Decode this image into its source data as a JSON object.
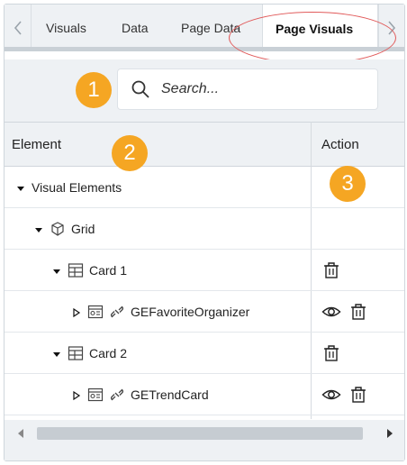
{
  "tabs": [
    {
      "label": "Visuals",
      "active": false
    },
    {
      "label": "Data",
      "active": false
    },
    {
      "label": "Page Data",
      "active": false
    },
    {
      "label": "Page Visuals",
      "active": true
    }
  ],
  "search": {
    "placeholder": "Search...",
    "value": ""
  },
  "badges": [
    "1",
    "2",
    "3"
  ],
  "table": {
    "headers": {
      "element": "Element",
      "action": "Action"
    },
    "rows": [
      {
        "label": "Visual Elements",
        "expanded": true,
        "icon": "",
        "actions": []
      },
      {
        "label": "Grid",
        "expanded": true,
        "icon": "cube-icon",
        "actions": []
      },
      {
        "label": "Card 1",
        "expanded": true,
        "icon": "card-layout-icon",
        "actions": [
          "trash-icon"
        ]
      },
      {
        "label": "GEFavoriteOrganizer",
        "expanded": false,
        "icon": "widget-icon",
        "actions": [
          "eye-icon",
          "trash-icon"
        ]
      },
      {
        "label": "Card 2",
        "expanded": true,
        "icon": "card-layout-icon",
        "actions": [
          "trash-icon"
        ]
      },
      {
        "label": "GETrendCard",
        "expanded": false,
        "icon": "widget-icon",
        "actions": [
          "eye-icon",
          "trash-icon"
        ]
      }
    ]
  },
  "colors": {
    "badge": "#f5a623",
    "highlight": "#e15a5a",
    "panel": "#eef1f4"
  }
}
